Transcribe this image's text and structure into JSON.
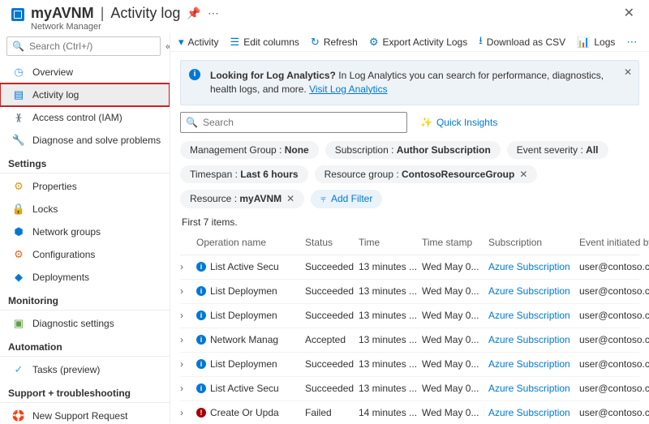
{
  "header": {
    "resource_name": "myAVNM",
    "page_name": "Activity log",
    "resource_type": "Network Manager"
  },
  "sidebar": {
    "search_placeholder": "Search (Ctrl+/)",
    "items": [
      {
        "icon": "overview-icon",
        "label": "Overview",
        "color": "#4aa0e6"
      },
      {
        "icon": "activitylog-icon",
        "label": "Activity log",
        "color": "#0078d4",
        "selected": true
      },
      {
        "icon": "access-icon",
        "label": "Access control (IAM)",
        "color": "#6b7785"
      },
      {
        "icon": "diagnose-icon",
        "label": "Diagnose and solve problems",
        "color": "#323130"
      }
    ],
    "sections": [
      {
        "title": "Settings",
        "items": [
          {
            "icon": "properties-icon",
            "label": "Properties",
            "color": "#d29b2f"
          },
          {
            "icon": "locks-icon",
            "label": "Locks",
            "color": "#6b7785"
          },
          {
            "icon": "netgroups-icon",
            "label": "Network groups",
            "color": "#0078d4"
          },
          {
            "icon": "config-icon",
            "label": "Configurations",
            "color": "#d66b2c"
          },
          {
            "icon": "deploy-icon",
            "label": "Deployments",
            "color": "#0078d4"
          }
        ]
      },
      {
        "title": "Monitoring",
        "items": [
          {
            "icon": "diagset-icon",
            "label": "Diagnostic settings",
            "color": "#5fa046"
          }
        ]
      },
      {
        "title": "Automation",
        "items": [
          {
            "icon": "tasks-icon",
            "label": "Tasks (preview)",
            "color": "#4aa0e6"
          }
        ]
      },
      {
        "title": "Support + troubleshooting",
        "items": [
          {
            "icon": "support-icon",
            "label": "New Support Request",
            "color": "#4aa0e6"
          }
        ]
      }
    ]
  },
  "toolbar": {
    "activity": "Activity",
    "edit_columns": "Edit columns",
    "refresh": "Refresh",
    "export": "Export Activity Logs",
    "download": "Download as CSV",
    "logs": "Logs"
  },
  "banner": {
    "heading": "Looking for Log Analytics?",
    "body": "In Log Analytics you can search for performance, diagnostics, health logs, and more.",
    "link": "Visit Log Analytics"
  },
  "main_search_placeholder": "Search",
  "quick_insights": "Quick Insights",
  "filters": [
    {
      "label": "Management Group : ",
      "value": "None",
      "close": false
    },
    {
      "label": "Subscription : ",
      "value": "Author Subscription",
      "close": false
    },
    {
      "label": "Event severity : ",
      "value": "All",
      "close": false
    },
    {
      "label": "Timespan : ",
      "value": "Last 6 hours",
      "close": false
    },
    {
      "label": "Resource group : ",
      "value": "ContosoResourceGroup",
      "close": true
    },
    {
      "label": "Resource : ",
      "value": "myAVNM",
      "close": true
    }
  ],
  "add_filter": "Add Filter",
  "item_count": "First 7 items.",
  "columns": {
    "op": "Operation name",
    "status": "Status",
    "time": "Time",
    "ts": "Time stamp",
    "sub": "Subscription",
    "by": "Event initiated by"
  },
  "rows": [
    {
      "icon": "info",
      "op": "List Active Secu",
      "status": "Succeeded",
      "time": "13 minutes ...",
      "ts": "Wed May 0...",
      "sub": "Azure Subscription",
      "by": "user@contoso.com"
    },
    {
      "icon": "info",
      "op": "List Deploymen",
      "status": "Succeeded",
      "time": "13 minutes ...",
      "ts": "Wed May 0...",
      "sub": "Azure Subscription",
      "by": "user@contoso.com"
    },
    {
      "icon": "info",
      "op": "List Deploymen",
      "status": "Succeeded",
      "time": "13 minutes ...",
      "ts": "Wed May 0...",
      "sub": "Azure Subscription",
      "by": "user@contoso.com"
    },
    {
      "icon": "info",
      "op": "Network Manag",
      "status": "Accepted",
      "time": "13 minutes ...",
      "ts": "Wed May 0...",
      "sub": "Azure Subscription",
      "by": "user@contoso.com"
    },
    {
      "icon": "info",
      "op": "List Deploymen",
      "status": "Succeeded",
      "time": "13 minutes ...",
      "ts": "Wed May 0...",
      "sub": "Azure Subscription",
      "by": "user@contoso.com"
    },
    {
      "icon": "info",
      "op": "List Active Secu",
      "status": "Succeeded",
      "time": "13 minutes ...",
      "ts": "Wed May 0...",
      "sub": "Azure Subscription",
      "by": "user@contoso.com"
    },
    {
      "icon": "fail",
      "op": "Create Or Upda",
      "status": "Failed",
      "time": "14 minutes ...",
      "ts": "Wed May 0...",
      "sub": "Azure Subscription",
      "by": "user@contoso.com"
    }
  ]
}
